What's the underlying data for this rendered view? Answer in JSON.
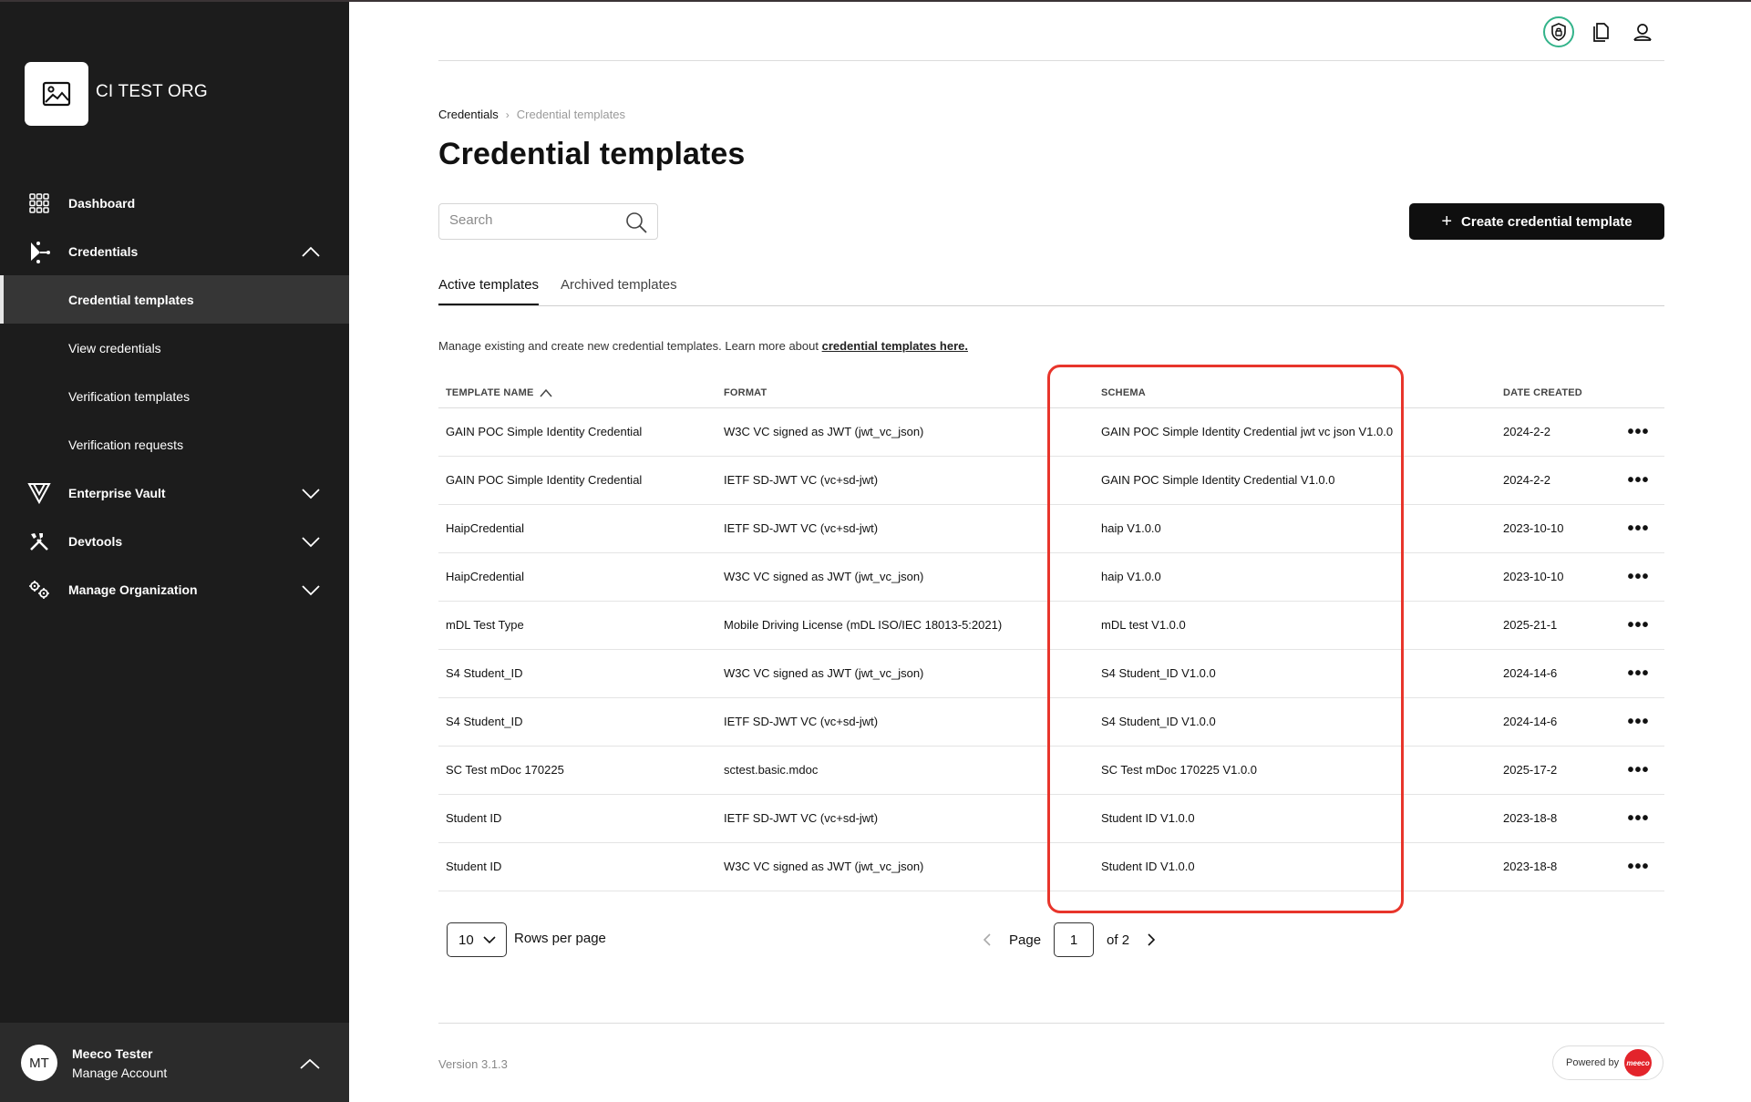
{
  "org": {
    "name": "CI TEST ORG"
  },
  "nav": {
    "dashboard": "Dashboard",
    "credentials": "Credentials",
    "credential_templates": "Credential templates",
    "view_credentials": "View credentials",
    "verification_templates": "Verification templates",
    "verification_requests": "Verification requests",
    "enterprise_vault": "Enterprise Vault",
    "devtools": "Devtools",
    "manage_organization": "Manage Organization"
  },
  "user": {
    "initials": "MT",
    "name": "Meeco Tester",
    "subtitle": "Manage Account"
  },
  "breadcrumb": {
    "parent": "Credentials",
    "separator": "›",
    "current": "Credential templates"
  },
  "page_title": "Credential templates",
  "search": {
    "placeholder": "Search",
    "value": ""
  },
  "create_button": {
    "label": "Create credential template"
  },
  "tabs": [
    {
      "label": "Active templates",
      "active": true
    },
    {
      "label": "Archived templates",
      "active": false
    }
  ],
  "description": {
    "text": "Manage existing and create new credential templates. Learn more about ",
    "link": "credential templates here."
  },
  "table": {
    "headers": [
      "TEMPLATE NAME",
      "FORMAT",
      "SCHEMA",
      "DATE CREATED"
    ],
    "sort": {
      "column": "TEMPLATE NAME",
      "direction": "ascending"
    },
    "actions_icon": "•••",
    "rows": [
      {
        "name": "GAIN POC Simple Identity Credential",
        "format": "W3C VC signed as JWT (jwt_vc_json)",
        "schema": "GAIN POC Simple Identity Credential jwt vc json V1.0.0",
        "date": "2024-2-2"
      },
      {
        "name": "GAIN POC Simple Identity Credential",
        "format": "IETF SD-JWT VC (vc+sd-jwt)",
        "schema": "GAIN POC Simple Identity Credential V1.0.0",
        "date": "2024-2-2"
      },
      {
        "name": "HaipCredential",
        "format": "IETF SD-JWT VC (vc+sd-jwt)",
        "schema": "haip V1.0.0",
        "date": "2023-10-10"
      },
      {
        "name": "HaipCredential",
        "format": "W3C VC signed as JWT (jwt_vc_json)",
        "schema": "haip V1.0.0",
        "date": "2023-10-10"
      },
      {
        "name": "mDL Test Type",
        "format": "Mobile Driving License (mDL ISO/IEC 18013-5:2021)",
        "schema": "mDL test V1.0.0",
        "date": "2025-21-1"
      },
      {
        "name": "S4 Student_ID",
        "format": "W3C VC signed as JWT (jwt_vc_json)",
        "schema": "S4 Student_ID V1.0.0",
        "date": "2024-14-6"
      },
      {
        "name": "S4 Student_ID",
        "format": "IETF SD-JWT VC (vc+sd-jwt)",
        "schema": "S4 Student_ID V1.0.0",
        "date": "2024-14-6"
      },
      {
        "name": "SC Test mDoc 170225",
        "format": "sctest.basic.mdoc",
        "schema": "SC Test mDoc 170225 V1.0.0",
        "date": "2025-17-2"
      },
      {
        "name": "Student ID",
        "format": "IETF SD-JWT VC (vc+sd-jwt)",
        "schema": "Student ID V1.0.0",
        "date": "2023-18-8"
      },
      {
        "name": "Student ID",
        "format": "W3C VC signed as JWT (jwt_vc_json)",
        "schema": "Student ID V1.0.0",
        "date": "2023-18-8"
      }
    ]
  },
  "pagination": {
    "rows_per_page": "10",
    "rows_label": "Rows per page",
    "page_label": "Page",
    "current_page": "1",
    "total_label": "of 2"
  },
  "footer": {
    "version": "Version 3.1.3",
    "powered_by": "Powered by",
    "logo_text": "meeco"
  },
  "colors": {
    "sidebar": "#1c1c1c",
    "active_item": "#363636",
    "accent": "#33b38a",
    "highlight": "#e8352b",
    "brand": "#e3242b"
  },
  "icons": {
    "header": [
      "shield-lock-icon",
      "documents-icon",
      "user-account-icon"
    ],
    "nav": [
      "grid-icon",
      "credentials-share-icon",
      "vault-icon",
      "tools-icon",
      "gears-icon"
    ]
  }
}
